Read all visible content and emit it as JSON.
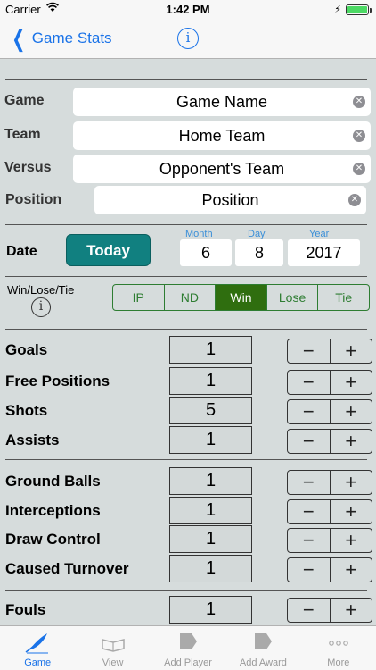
{
  "status": {
    "carrier": "Carrier",
    "time": "1:42 PM"
  },
  "nav": {
    "back_label": "Game Stats",
    "info": "i"
  },
  "form": {
    "game_label": "Game",
    "game_value": "Game Name",
    "team_label": "Team",
    "team_value": "Home Team",
    "versus_label": "Versus",
    "versus_value": "Opponent's Team",
    "position_label": "Position",
    "position_value": "Position"
  },
  "date": {
    "label": "Date",
    "today": "Today",
    "month_caption": "Month",
    "day_caption": "Day",
    "year_caption": "Year",
    "month": "6",
    "day": "8",
    "year": "2017"
  },
  "result": {
    "label": "Win/Lose/Tie",
    "info": "i",
    "options": [
      "IP",
      "ND",
      "Win",
      "Lose",
      "Tie"
    ],
    "selected": "Win"
  },
  "stats": [
    {
      "label": "Goals",
      "value": "1"
    },
    {
      "label": "Free Positions",
      "value": "1"
    },
    {
      "label": "Shots",
      "value": "5"
    },
    {
      "label": "Assists",
      "value": "1"
    },
    {
      "label": "Ground Balls",
      "value": "1"
    },
    {
      "label": "Interceptions",
      "value": "1"
    },
    {
      "label": "Draw Control",
      "value": "1"
    },
    {
      "label": "Caused Turnover",
      "value": "1"
    },
    {
      "label": "Fouls",
      "value": "1"
    }
  ],
  "stepper": {
    "minus": "−",
    "plus": "+"
  },
  "tabs": [
    {
      "label": "Game",
      "icon": "quill-icon",
      "active": true
    },
    {
      "label": "View",
      "icon": "book-icon",
      "active": false
    },
    {
      "label": "Add Player",
      "icon": "player-icon",
      "active": false
    },
    {
      "label": "Add Award",
      "icon": "award-icon",
      "active": false
    },
    {
      "label": "More",
      "icon": "more-icon",
      "active": false
    }
  ],
  "colors": {
    "accent": "#1a73e8",
    "today": "#118080",
    "selected_segment": "#2f6e0f",
    "background": "#d6dcdc"
  }
}
